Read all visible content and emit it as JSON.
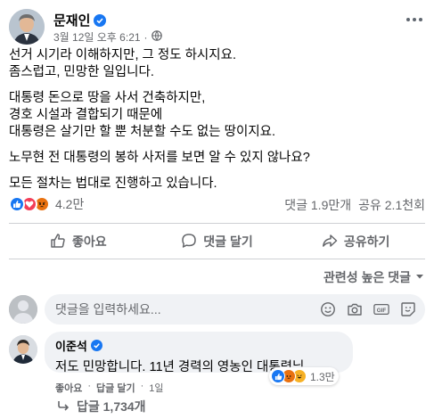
{
  "post": {
    "author": "문재인",
    "date": "3월 12일 오후 6:21",
    "dot": "·",
    "paragraphs": [
      [
        "선거 시기라 이해하지만, 그 정도 하시지요.",
        "좀스럽고, 민망한 일입니다."
      ],
      [
        "대통령 돈으로 땅을 사서 건축하지만,",
        "경호 시설과 결합되기 때문에",
        "대통령은 살기만 할 뿐 처분할 수도 없는 땅이지요."
      ],
      [
        "노무현 전 대통령의 봉하 사저를 보면 알 수 있지 않나요?"
      ],
      [
        "모든 절차는 법대로 진행하고 있습니다."
      ]
    ],
    "reaction_count": "4.2만",
    "comments_count": "댓글 1.9만개",
    "shares_count": "공유 2.1천회"
  },
  "actions": {
    "like": "좋아요",
    "comment": "댓글 달기",
    "share": "공유하기"
  },
  "sort_label": "관련성 높은 댓글",
  "composer": {
    "placeholder": "댓글을 입력하세요..."
  },
  "comment": {
    "author": "이준석",
    "text": "저도 민망합니다. 11년 경력의 영농인 대통령님.",
    "reaction_count": "1.3만",
    "like": "좋아요",
    "reply": "답글 달기",
    "dot": "·",
    "time": "1일",
    "replies": "답글 1,734개"
  },
  "colors": {
    "like_blue": "#1877f2",
    "love_red": "#f33e58",
    "angry_orange": "#e9710f",
    "haha_yellow": "#f7b125",
    "verified_blue": "#1877f2",
    "secondary_text": "#65676b"
  },
  "icons": {
    "reactions": [
      "like-icon",
      "love-icon",
      "angry-icon"
    ],
    "comment_reactions": [
      "like-icon",
      "angry-icon",
      "haha-icon"
    ],
    "composer_tools": [
      "emoji-icon",
      "camera-icon",
      "gif-icon",
      "sticker-icon"
    ]
  }
}
